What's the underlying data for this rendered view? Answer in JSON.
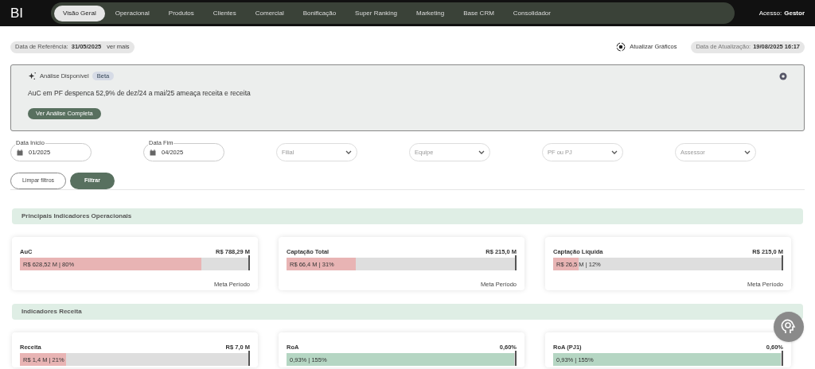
{
  "nav": {
    "logo": "BI",
    "tabs": [
      {
        "label": "Visão Geral",
        "selected": true
      },
      {
        "label": "Operacional",
        "selected": false
      },
      {
        "label": "Produtos",
        "selected": false
      },
      {
        "label": "Clientes",
        "selected": false
      },
      {
        "label": "Comercial",
        "selected": false
      },
      {
        "label": "Bonificação",
        "selected": false
      },
      {
        "label": "Super Ranking",
        "selected": false
      },
      {
        "label": "Marketing",
        "selected": false
      },
      {
        "label": "Base CRM",
        "selected": false
      },
      {
        "label": "Consolidador",
        "selected": false
      }
    ],
    "access_label": "Acesso:",
    "access_value": "Gestor"
  },
  "info_bar": {
    "reference_label": "Data de Referência:",
    "reference_value": "31/05/2025",
    "see_more": "ver mais",
    "refresh": "Atualizar Gráficos",
    "update_label": "Data de Atualização:",
    "update_value": "19/08/2025 16:17"
  },
  "analysis": {
    "title": "Análise Disponível",
    "badge": "Beta",
    "text": "AuC em PF despenca 52,9% de dez/24 a mai/25 ameaça receita e receita",
    "button": "Ver Análise Completa"
  },
  "filters": [
    {
      "kind": "date",
      "label": "Data Início",
      "value": "01/2025"
    },
    {
      "kind": "date",
      "label": "Data Fim",
      "value": "04/2025"
    },
    {
      "kind": "select",
      "placeholder": "Filial"
    },
    {
      "kind": "select",
      "placeholder": "Equipe"
    },
    {
      "kind": "select",
      "placeholder": "PF ou PJ"
    },
    {
      "kind": "select",
      "placeholder": "Assessor"
    }
  ],
  "filter_buttons": {
    "clear": "Limpar filtros",
    "apply": "Filtrar"
  },
  "sections": [
    {
      "title": "Principais Indicadores Operacionais",
      "cards": [
        {
          "title": "AuC",
          "target": "R$ 788,29 M",
          "value": "R$ 628,52 M | 80%",
          "level": 0.8,
          "color": "#e8b4b4",
          "target_caption": "Meta Período"
        },
        {
          "title": "Captação Total",
          "target": "R$ 215,0 M",
          "value": "R$ 66,4 M | 31%",
          "level": 0.31,
          "color": "#e8b4b4",
          "target_caption": "Meta Período"
        },
        {
          "title": "Captação Líquida",
          "target": "R$ 215,0 M",
          "value": "R$ 26,5 M | 12%",
          "level": 0.12,
          "color": "#e8b4b4",
          "target_caption": "Meta Período"
        }
      ]
    },
    {
      "title": "Indicadores Receita",
      "cards": [
        {
          "title": "Receita",
          "target": "R$ 7,0 M",
          "value": "R$ 1,4 M | 21%",
          "level": 0.21,
          "color": "#e8b4b4"
        },
        {
          "title": "RoA",
          "target": "0,60%",
          "value": "0,93% | 155%",
          "level": 1,
          "color": "#b5d6c3"
        },
        {
          "title": "RoA (PJ1)",
          "target": "0,60%",
          "value": "0,93% | 155%",
          "level": 1,
          "color": "#b5d6c3"
        }
      ]
    }
  ]
}
